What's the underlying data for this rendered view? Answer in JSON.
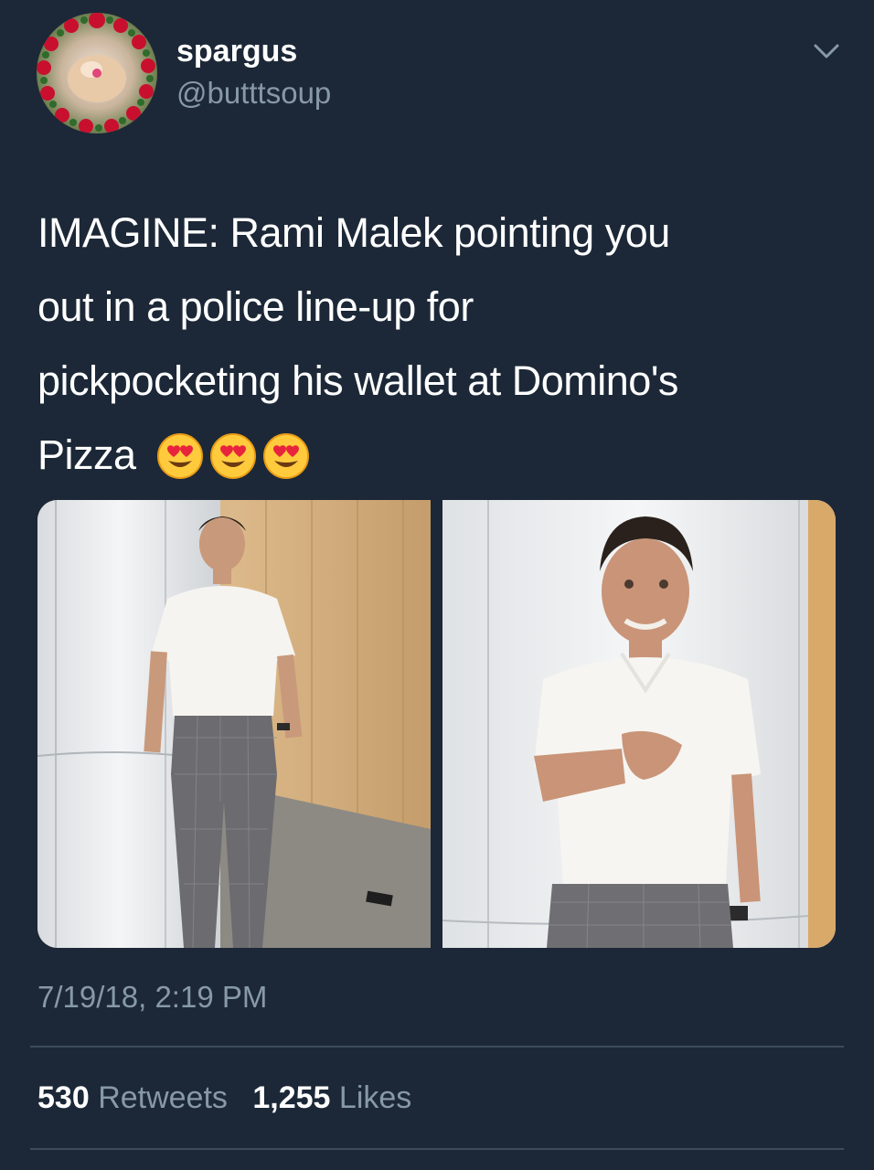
{
  "tweet": {
    "author": {
      "display_name": "spargus",
      "handle": "@butttsoup",
      "avatar_icon": "rose-wreath-avatar"
    },
    "menu_icon": "chevron-down-icon",
    "text": "IMAGINE: Rami Malek pointing you\nout in a police line-up for\npickpocketing his wallet at Domino's\nPizza ",
    "emojis": [
      "heart-eyes-emoji",
      "heart-eyes-emoji",
      "heart-eyes-emoji"
    ],
    "photos": [
      {
        "icon": "photo-man-leaning-against-pillar"
      },
      {
        "icon": "photo-man-pointing"
      }
    ],
    "timestamp": "7/19/18, 2:19 PM",
    "stats": {
      "retweets_count": "530",
      "retweets_label": "Retweets",
      "likes_count": "1,255",
      "likes_label": "Likes"
    }
  },
  "colors": {
    "background": "#1c2837",
    "secondary_text": "#8899a6",
    "divider": "#3d4b5a",
    "text": "#ffffff"
  }
}
